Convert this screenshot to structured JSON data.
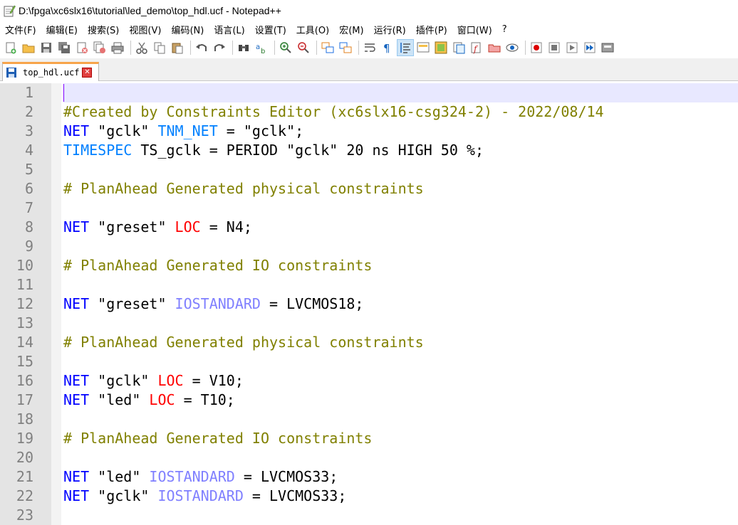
{
  "window": {
    "title": "D:\\fpga\\xc6slx16\\tutorial\\led_demo\\top_hdl.ucf - Notepad++"
  },
  "menu": [
    "文件(F)",
    "编辑(E)",
    "搜索(S)",
    "视图(V)",
    "编码(N)",
    "语言(L)",
    "设置(T)",
    "工具(O)",
    "宏(M)",
    "运行(R)",
    "插件(P)",
    "窗口(W)",
    "?"
  ],
  "tab": {
    "label": "top_hdl.ucf"
  },
  "editor": {
    "current_line": 1,
    "lines": [
      {
        "n": "1",
        "tokens": []
      },
      {
        "n": "2",
        "tokens": [
          {
            "t": "#Created by Constraints Editor (xc6slx16-csg324-2) - 2022/08/14",
            "c": "comment"
          }
        ]
      },
      {
        "n": "3",
        "tokens": [
          {
            "t": "NET",
            "c": "kw"
          },
          {
            "t": " \"gclk\" ",
            "c": "str"
          },
          {
            "t": "TNM_NET",
            "c": "kw2"
          },
          {
            "t": " = \"gclk\";",
            "c": "str"
          }
        ]
      },
      {
        "n": "4",
        "tokens": [
          {
            "t": "TIMESPEC",
            "c": "kw2"
          },
          {
            "t": " TS_gclk = PERIOD \"gclk\" 20 ns HIGH 50 %;",
            "c": "str"
          }
        ]
      },
      {
        "n": "5",
        "tokens": []
      },
      {
        "n": "6",
        "tokens": [
          {
            "t": "# PlanAhead Generated physical constraints ",
            "c": "comment"
          }
        ]
      },
      {
        "n": "7",
        "tokens": []
      },
      {
        "n": "8",
        "tokens": [
          {
            "t": "NET",
            "c": "kw"
          },
          {
            "t": " \"greset\" ",
            "c": "str"
          },
          {
            "t": "LOC",
            "c": "loc"
          },
          {
            "t": " = N4;",
            "c": "str"
          }
        ]
      },
      {
        "n": "9",
        "tokens": []
      },
      {
        "n": "10",
        "tokens": [
          {
            "t": "# PlanAhead Generated IO constraints ",
            "c": "comment"
          }
        ]
      },
      {
        "n": "11",
        "tokens": []
      },
      {
        "n": "12",
        "tokens": [
          {
            "t": "NET",
            "c": "kw"
          },
          {
            "t": " \"greset\" ",
            "c": "str"
          },
          {
            "t": "IOSTANDARD",
            "c": "io"
          },
          {
            "t": " = LVCMOS18;",
            "c": "str"
          }
        ]
      },
      {
        "n": "13",
        "tokens": []
      },
      {
        "n": "14",
        "tokens": [
          {
            "t": "# PlanAhead Generated physical constraints ",
            "c": "comment"
          }
        ]
      },
      {
        "n": "15",
        "tokens": []
      },
      {
        "n": "16",
        "tokens": [
          {
            "t": "NET",
            "c": "kw"
          },
          {
            "t": " \"gclk\" ",
            "c": "str"
          },
          {
            "t": "LOC",
            "c": "loc"
          },
          {
            "t": " = V10;",
            "c": "str"
          }
        ]
      },
      {
        "n": "17",
        "tokens": [
          {
            "t": "NET",
            "c": "kw"
          },
          {
            "t": " \"led\" ",
            "c": "str"
          },
          {
            "t": "LOC",
            "c": "loc"
          },
          {
            "t": " = T10;",
            "c": "str"
          }
        ]
      },
      {
        "n": "18",
        "tokens": []
      },
      {
        "n": "19",
        "tokens": [
          {
            "t": "# PlanAhead Generated IO constraints ",
            "c": "comment"
          }
        ]
      },
      {
        "n": "20",
        "tokens": []
      },
      {
        "n": "21",
        "tokens": [
          {
            "t": "NET",
            "c": "kw"
          },
          {
            "t": " \"led\" ",
            "c": "str"
          },
          {
            "t": "IOSTANDARD",
            "c": "io"
          },
          {
            "t": " = LVCMOS33;",
            "c": "str"
          }
        ]
      },
      {
        "n": "22",
        "tokens": [
          {
            "t": "NET",
            "c": "kw"
          },
          {
            "t": " \"gclk\" ",
            "c": "str"
          },
          {
            "t": "IOSTANDARD",
            "c": "io"
          },
          {
            "t": " = LVCMOS33;",
            "c": "str"
          }
        ]
      },
      {
        "n": "23",
        "tokens": []
      }
    ]
  },
  "toolbar_icons": [
    "new-file-icon",
    "open-file-icon",
    "save-icon",
    "save-all-icon",
    "close-icon",
    "close-all-icon",
    "print-icon",
    "cut-icon",
    "copy-icon",
    "paste-icon",
    "undo-icon",
    "redo-icon",
    "find-icon",
    "replace-icon",
    "zoom-in-icon",
    "zoom-out-icon",
    "sync-vertical-icon",
    "sync-horizontal-icon",
    "word-wrap-icon",
    "show-all-chars-icon",
    "indent-guide-icon",
    "language-udl-icon",
    "document-map-icon",
    "function-list-icon",
    "folder-workspace-icon",
    "monitoring-icon",
    "record-macro-icon",
    "stop-macro-icon",
    "play-macro-icon",
    "run-macro-multiple-icon",
    "save-macro-icon"
  ],
  "colors": {
    "comment": "#808000",
    "kw": "#0000ff",
    "kw2": "#0080ff",
    "loc": "#ff0000",
    "io": "#8080ff",
    "tab_accent": "#f7a44a",
    "current_line": "#e8e8ff"
  }
}
